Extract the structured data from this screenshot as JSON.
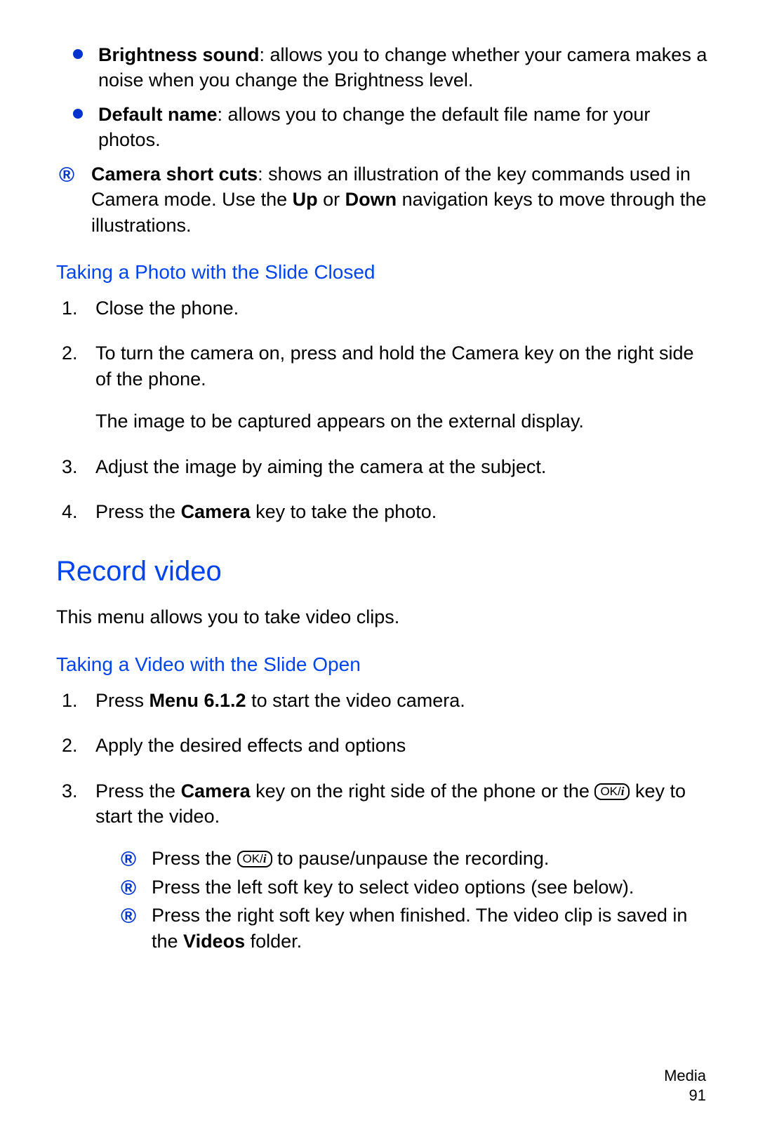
{
  "bullets": [
    {
      "term": "Brightness sound",
      "desc": ": allows you to change whether your camera makes a noise when you change the Brightness level."
    },
    {
      "term": "Default name",
      "desc": ": allows you to change the default file name for your photos."
    }
  ],
  "shortcuts": {
    "term": "Camera short cuts",
    "part1": ": shows an illustration of the key commands used in Camera mode. Use the ",
    "up": "Up",
    "mid": " or ",
    "down": "Down",
    "part2": " navigation keys to move through the illustrations."
  },
  "rmark": "®",
  "subheading1": "Taking a Photo with the Slide Closed",
  "steps1": [
    {
      "text": "Close the phone."
    },
    {
      "text": "To turn the camera on, press and hold the Camera key on the right side of the phone.",
      "extra": "The image to be captured appears on the external display."
    },
    {
      "text": "Adjust the image by aiming the camera at the subject."
    },
    {
      "pre": "Press the ",
      "bold": "Camera",
      "post": " key to take the photo."
    }
  ],
  "section": "Record video",
  "section_desc": "This menu allows you to take video clips.",
  "subheading2": "Taking a Video with the Slide Open",
  "steps2": {
    "s1": {
      "pre": "Press ",
      "bold": "Menu 6.1.2",
      "post": " to start the video camera."
    },
    "s2": "Apply the desired effects and options",
    "s3": {
      "pre": "Press the ",
      "bold": "Camera",
      "mid": " key on the right side of the phone or the  ",
      "post": "  key to start the video."
    }
  },
  "okkey": {
    "label": "OK/",
    "i": "i"
  },
  "sub_r": {
    "a_pre": "Press the  ",
    "a_post": "  to pause/unpause the recording.",
    "b": "Press the left soft key to select video options (see below).",
    "c_pre": "Press the right soft key when finished. The video clip is saved in the ",
    "c_bold": "Videos",
    "c_post": " folder."
  },
  "footer": {
    "section": "Media",
    "page": "91"
  }
}
